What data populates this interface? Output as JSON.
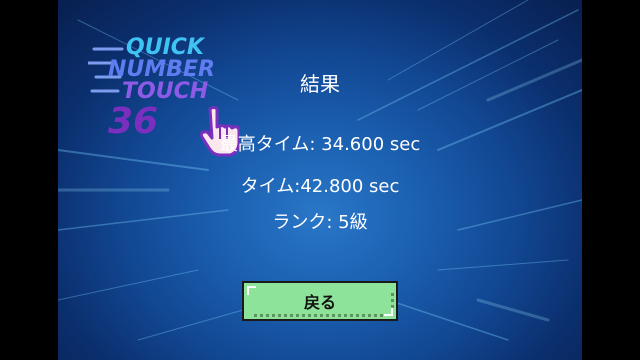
{
  "logo": {
    "line1": "QUICK",
    "line2": "NUMBER",
    "line3": "TOUCH",
    "line4": "36"
  },
  "result": {
    "title": "結果",
    "best_time": "最高タイム: 34.600 sec",
    "time": "タイム:42.800 sec",
    "rank": "ランク: 5級"
  },
  "buttons": {
    "back_label": "戻る"
  },
  "colors": {
    "background_center": "#2a77c8",
    "background_edge": "#081f4f",
    "button_fill": "#8ee39a",
    "logo_cyan": "#3ec3f2",
    "logo_purple": "#7a2fbf"
  },
  "icons": {
    "logo_hand": "pointing-hand-icon"
  }
}
